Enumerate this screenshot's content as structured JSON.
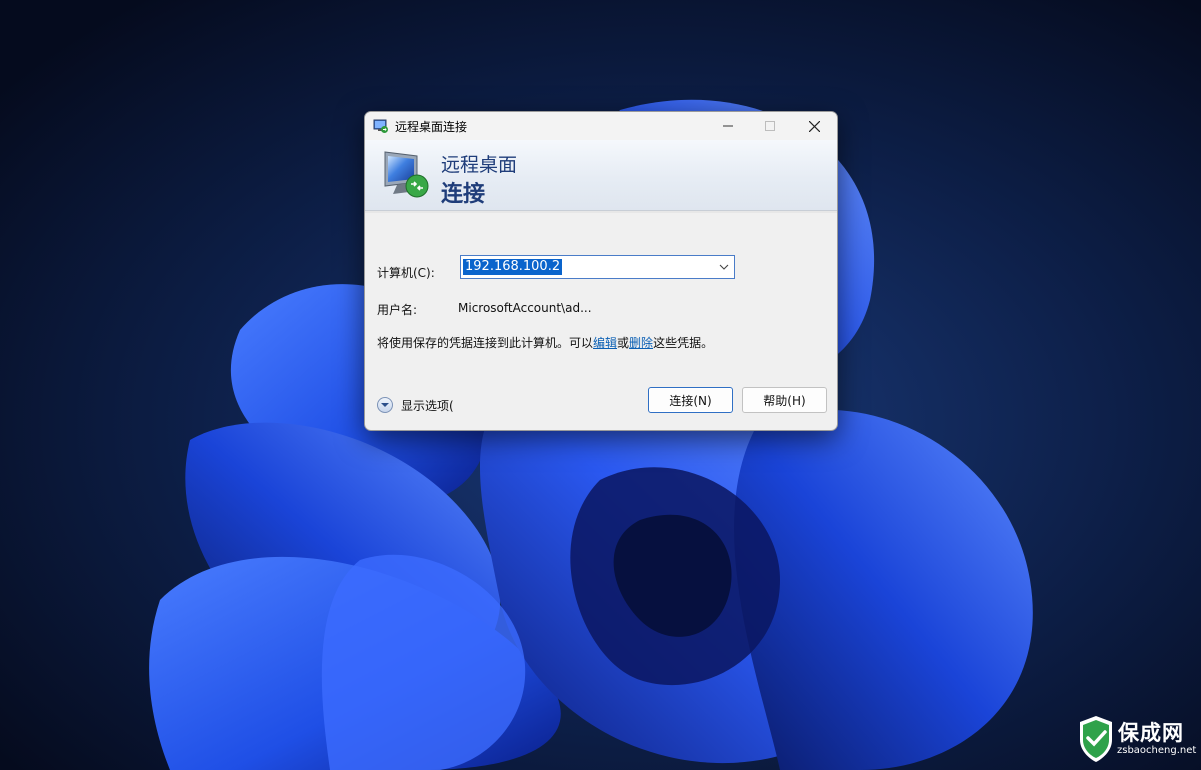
{
  "window": {
    "title": "远程桌面连接",
    "banner_line1": "远程桌面",
    "banner_line2": "连接"
  },
  "form": {
    "computer_label": "计算机(C):",
    "computer_value": "192.168.100.2",
    "username_label": "用户名:",
    "username_value": "MicrosoftAccount\\ad...",
    "notice_prefix": "将使用保存的凭据连接到此计算机。可以",
    "notice_link_edit": "编辑",
    "notice_or": "或",
    "notice_link_delete": "删除",
    "notice_suffix": "这些凭据。"
  },
  "footer": {
    "show_options_label": "显示选项(",
    "connect_label": "连接(N)",
    "help_label": "帮助(H)"
  },
  "watermark": {
    "title": "保成网",
    "url": "zsbaocheng.net"
  },
  "icons": [
    "remote-desktop-app-icon",
    "minimize-icon",
    "maximize-icon",
    "close-icon",
    "remote-desktop-monitor-icon",
    "chevron-down-icon",
    "expand-options-icon",
    "watermark-logo-icon"
  ],
  "colors": {
    "wallpaper_bg": "#0a1530",
    "wallpaper_accent": "#1f4fe6",
    "selection": "#0a64cc",
    "banner_text": "#1f3d7a",
    "link": "#0a5fb4"
  }
}
